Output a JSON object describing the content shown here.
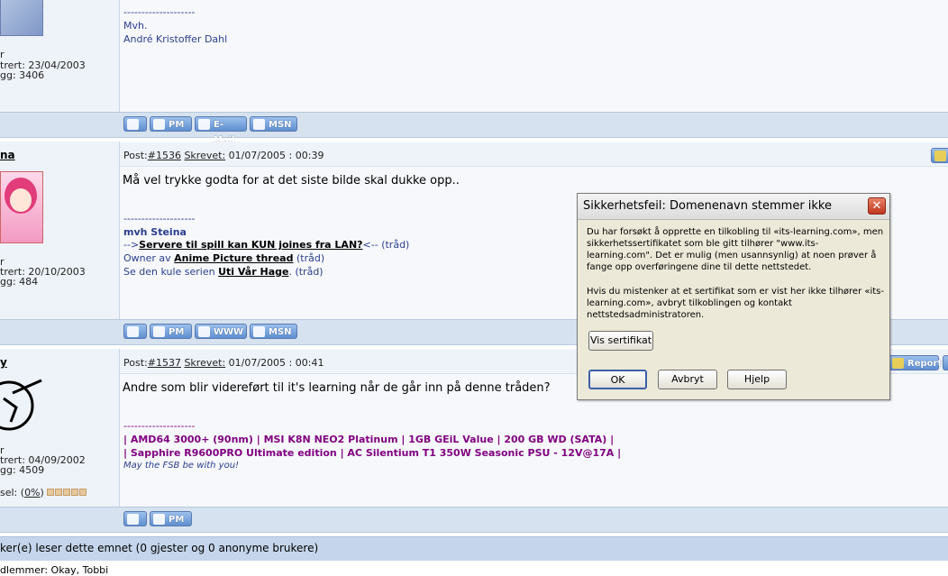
{
  "post1": {
    "sig_dashes": "--------------------",
    "sig_line1": "Mvh.",
    "sig_line2": "André Kristoffer Dahl",
    "user_rank": "r",
    "registered": "trert: 23/04/2003",
    "posts": "gg: 3406",
    "buttons": [
      "PM",
      "E-Mail",
      "MSN"
    ]
  },
  "post2": {
    "username": "na",
    "post_label": "Post:",
    "post_num": "#1536",
    "written_label": "Skrevet:",
    "datetime": "01/07/2005 : 00:39",
    "message": "Må vel trykke godta for at det siste bilde skal dukke opp..",
    "sig_dashes": "--------------------",
    "sig_name": "mvh Steina",
    "sig_arrow_l": "-->",
    "sig_link1": "Servere til spill kan KUN joines fra LAN?",
    "sig_arrow_r": "<-- ",
    "sig_thread1": "(tråd)",
    "sig_owner": "Owner av ",
    "sig_link2": "Anime Picture thread",
    "sig_thread2": " (tråd)",
    "sig_serie": "Se den kule serien ",
    "sig_link3": "Uti Vår Hage",
    "sig_thread3": ". (tråd)",
    "user_rank": "r",
    "registered": "trert: 20/10/2003",
    "posts": "gg: 484",
    "buttons": [
      "PM",
      "WWW",
      "MSN"
    ]
  },
  "post3": {
    "username": "y",
    "post_label": "Post:",
    "post_num": "#1537",
    "written_label": "Skrevet:",
    "datetime": "01/07/2005 : 00:41",
    "report_label": "Report",
    "message": "Andre som blir videreført til it's learning når de går inn på denne tråden?",
    "sig_dashes": "--------------------",
    "sig_line1": "| AMD64 3000+ (90nm) | MSI K8N NEO2 Platinum | 1GB GEiL Value | 200 GB WD (SATA) |",
    "sig_line2": "| Sapphire R9600PRO Ultimate edition | AC Silentium T1 350W Seasonic PSU - 12V@17A |",
    "sig_line3": "May the FSB be with you!",
    "user_rank": "r",
    "registered": "trert: 04/09/2002",
    "posts": "gg: 4509",
    "karma_label": "sel: (",
    "karma_value": "0%",
    "karma_close": ")",
    "buttons": [
      "PM"
    ]
  },
  "footer": {
    "readers": "ker(e) leser dette emnet (0 gjester og 0 anonyme brukere)",
    "members": "dlemmer: Okay, Tobbi"
  },
  "dialog": {
    "title": "Sikkerhetsfeil: Domenenavn stemmer ikke",
    "close": "✕",
    "para1": "Du har forsøkt å opprette en tilkobling til «its-learning.com», men sikkerhetssertifikatet som ble gitt tilhører \"www.its-learning.com\". Det er mulig (men usannsynlig) at noen prøver å fange opp overføringene dine til dette nettstedet.",
    "para2": "Hvis du mistenker at et sertifikat som er vist her ikke tilhører «its-learning.com», avbryt tilkoblingen og kontakt nettstedsadministratoren.",
    "view_cert": "Vis sertifikat",
    "ok": "OK",
    "cancel": "Avbryt",
    "help": "Hjelp"
  },
  "colors": {
    "bar": "#d6e2ef",
    "link_navy": "#2c3e8c",
    "sig_purple": "#800080"
  }
}
